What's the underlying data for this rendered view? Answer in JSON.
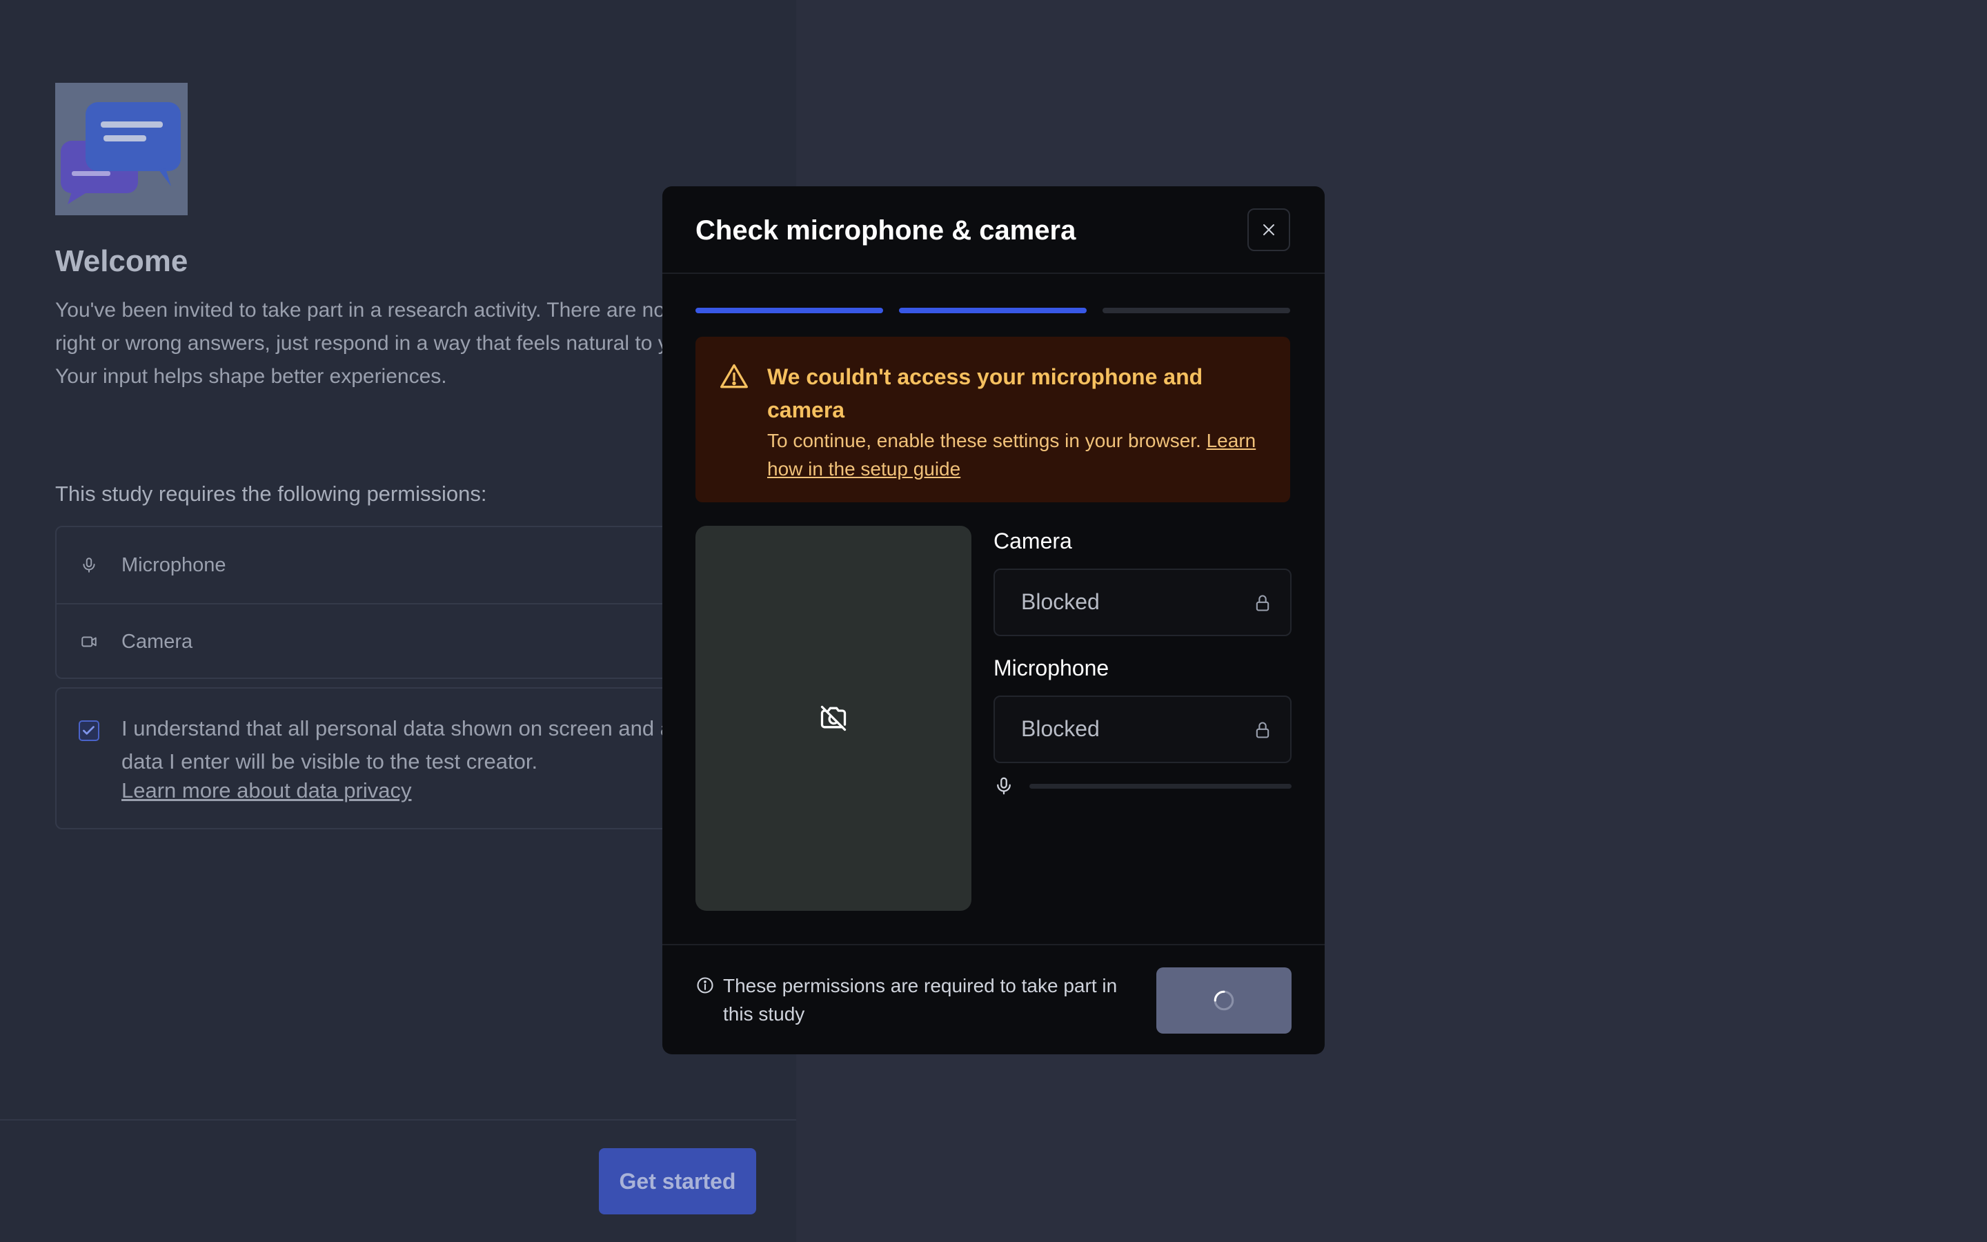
{
  "welcome": {
    "title": "Welcome",
    "intro": "You've been invited to take part in a research activity. There are no\nright or wrong answers, just respond in a way that feels natural to you.\nYour input helps shape better experiences.",
    "permissions_heading": "This study requires the following permissions:",
    "permissions": [
      {
        "label": "Microphone",
        "icon": "microphone-icon"
      },
      {
        "label": "Camera",
        "icon": "video-camera-icon"
      }
    ],
    "consent_text": "I understand that all personal data shown on screen and any",
    "consent_text_2": "data I enter will be visible to the test creator.",
    "consent_link": "Learn more about data privacy",
    "consent_checked": true,
    "get_started_label": "Get started"
  },
  "modal": {
    "title": "Check microphone & camera",
    "progress_steps_total": 3,
    "progress_steps_complete": 2,
    "alert": {
      "title": "We couldn't access your microphone and camera",
      "body": "To continue, enable these settings in your browser.",
      "link": "Learn how in the setup guide",
      "icon": "warning-triangle-icon"
    },
    "camera": {
      "label": "Camera",
      "value": "Blocked",
      "icon": "lock-icon"
    },
    "microphone": {
      "label": "Microphone",
      "value": "Blocked",
      "icon": "lock-icon"
    },
    "mic_level": 0,
    "footer_text": "These permissions are required to take part in this study",
    "continue_state": "loading"
  },
  "colors": {
    "accent": "#3858e6",
    "alert_bg": "#2f1207",
    "alert_text": "#f6c05f",
    "modal_bg": "#0b0c0f",
    "page_bg": "#2b2f3e"
  }
}
